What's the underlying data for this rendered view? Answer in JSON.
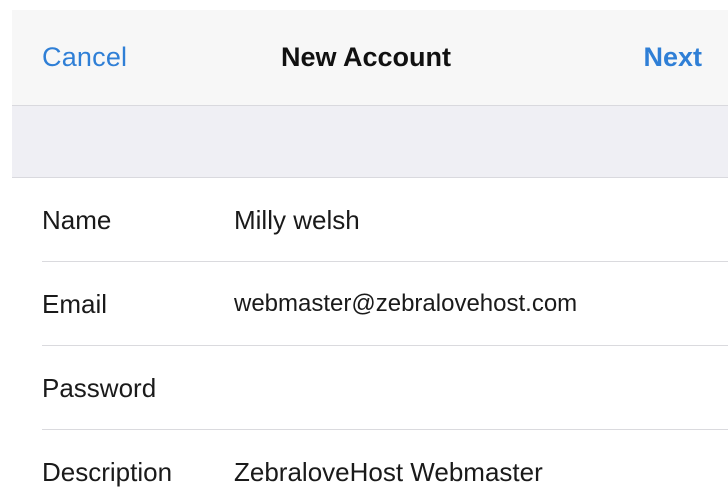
{
  "nav": {
    "cancel_label": "Cancel",
    "title": "New Account",
    "next_label": "Next"
  },
  "form": {
    "rows": [
      {
        "label": "Name",
        "value": "Milly welsh"
      },
      {
        "label": "Email",
        "value": "webmaster@zebralovehost.com"
      },
      {
        "label": "Password",
        "value": ""
      },
      {
        "label": "Description",
        "value": "ZebraloveHost Webmaster"
      }
    ]
  },
  "colors": {
    "accent": "#2f7fd6",
    "nav_background": "#f7f7f7",
    "section_background": "#efeff4",
    "separator": "#dadade"
  }
}
